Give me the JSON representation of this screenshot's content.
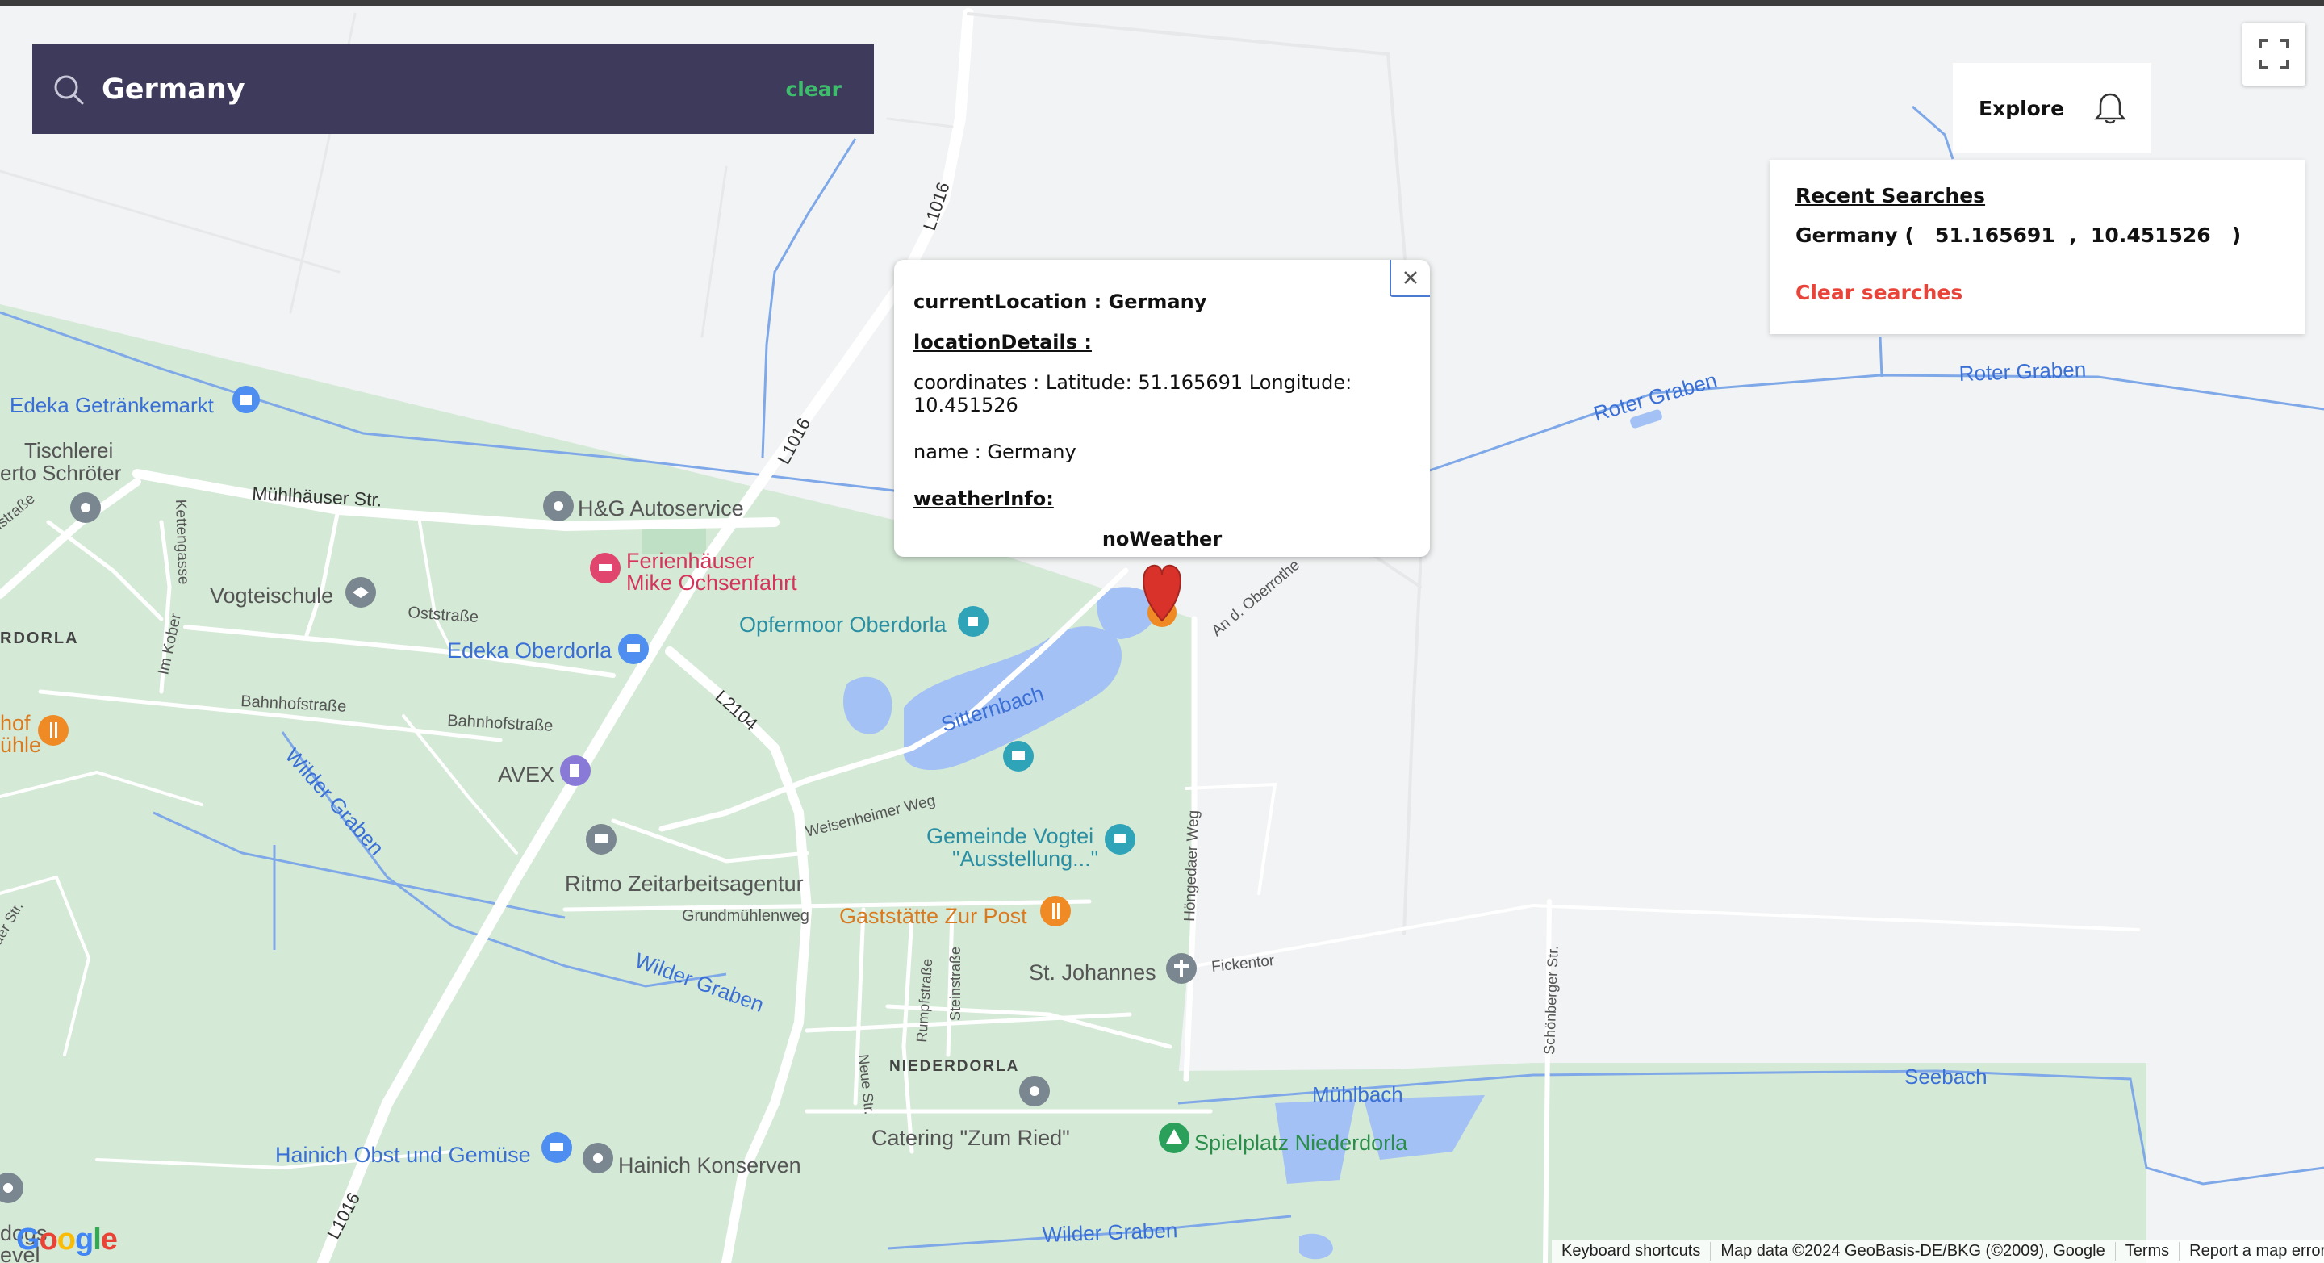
{
  "search": {
    "value": "Germany",
    "clear_label": "clear"
  },
  "explore": {
    "label": "Explore"
  },
  "recent_searches": {
    "title": "Recent Searches",
    "items": [
      {
        "text": "Germany (   51.165691  ,  10.451526   )"
      }
    ],
    "clear_label": "Clear searches"
  },
  "info_window": {
    "current_location": "currentLocation : Germany",
    "location_details_title": "locationDetails :",
    "coordinates": "coordinates : Latitude: 51.165691 Longitude: 10.451526",
    "name": "name : Germany",
    "weather_title": "weatherInfo:",
    "weather_value": "noWeather",
    "close_icon": "close-icon"
  },
  "map": {
    "labels": {
      "edeka_getraenke": "Edeka Getränkemarkt",
      "tischlerei": "Tischlerei",
      "erto_schroeter": "erto Schröter",
      "muehlhaeuser_str": "Mühlhäuser Str.",
      "hg_autoservice": "H&G Autoservice",
      "ferienhaeuser1": "Ferienhäuser",
      "ferienhaeuser2": "Mike Ochsenfahrt",
      "vogteischule": "Vogteischule",
      "oststrasse": "Oststraße",
      "rdorla": "RDORLA",
      "im_kober": "Im Kober",
      "kettengasse": "Kettengasse",
      "istrasse": "istraße",
      "edeka_oberdorla": "Edeka Oberdorla",
      "opfermoor": "Opfermoor Oberdorla",
      "bahnhofstrasse1": "Bahnhofstraße",
      "bahnhofstrasse2": "Bahnhofstraße",
      "hof": "hof",
      "uhle": "ühle",
      "wilder_graben1": "Wilder Graben",
      "wilder_graben2": "Wilder Graben",
      "wilder_graben3": "Wilder Graben",
      "sitternbach": "Sitternbach",
      "l2104": "L2104",
      "avex": "AVEX",
      "l1016_1": "L1016",
      "l1016_2": "L1016",
      "l1016_3": "L1016",
      "an_d_oberrothe": "An d. Oberrothe",
      "weisenheimer_weg": "Weisenheimer Weg",
      "gemeinde1": "Gemeinde Vogtei",
      "gemeinde2": "\"Ausstellung...\"",
      "ritmo": "Ritmo Zeitarbeitsagentur",
      "grundmuehlenweg": "Grundmühlenweg",
      "gaststaette": "Gaststätte Zur Post",
      "hoengedaer_weg": "Höngedaer Weg",
      "st_johannes": "St. Johannes",
      "fickentor": "Fickentor",
      "rumpfstrasse": "Rumpfstraße",
      "steinstrasse": "Steinstraße",
      "niederdorla": "NIEDERDORLA",
      "neue_str": "Neue Str.",
      "catering": "Catering \"Zum Ried\"",
      "spielplatz": "Spielplatz Niederdorla",
      "muehlbach": "Mühlbach",
      "seebach": "Seebach",
      "schoenberger_str": "Schönberger Str.",
      "roter_graben1": "Roter Graben",
      "roter_graben2": "Roter Graben",
      "hainich_obst": "Hainich Obst und Gemüse",
      "hainich_konserven": "Hainich Konserven",
      "aer_str": "aer Str.",
      "dogs": "dogs",
      "evel": "evel"
    },
    "google_logo": "Google",
    "colors": {
      "land": "#f1f3f4",
      "green": "#d4e9d6",
      "water": "#a3c1f5",
      "water_line": "#7fa8e8",
      "road": "#ffffff"
    }
  },
  "footer": {
    "keyboard": "Keyboard shortcuts",
    "map_data": "Map data ©2024 GeoBasis-DE/BKG (©2009), Google",
    "terms": "Terms",
    "report": "Report a map error"
  }
}
